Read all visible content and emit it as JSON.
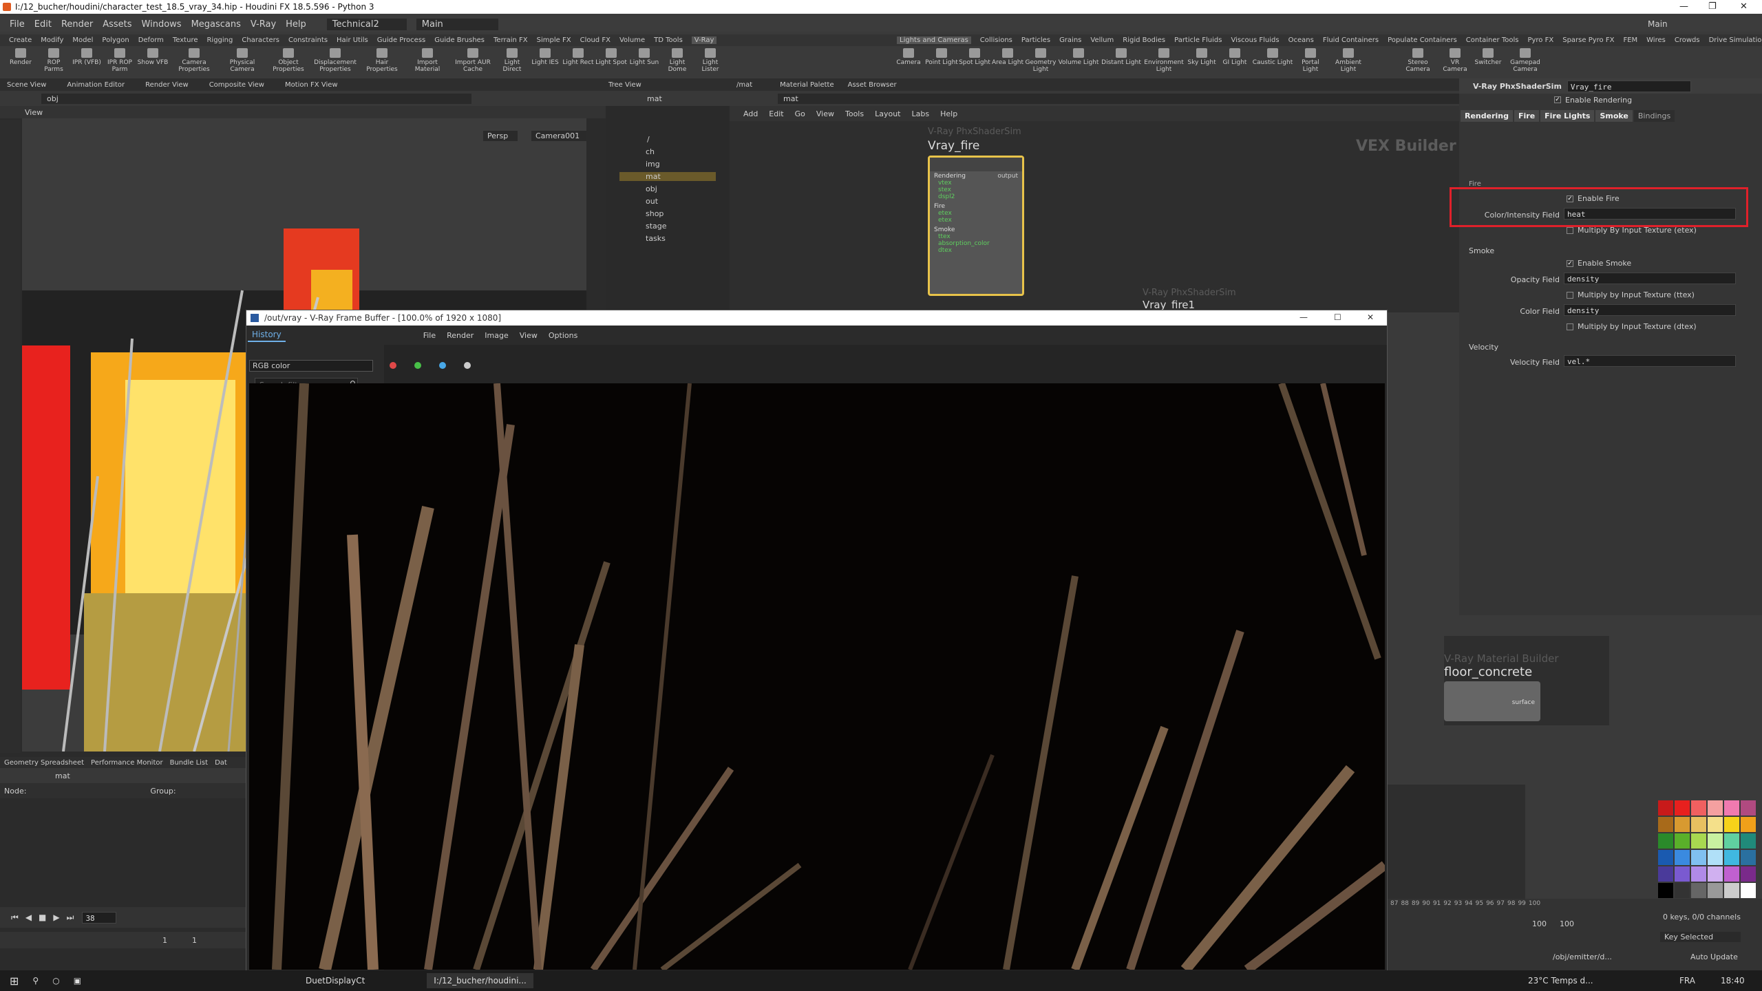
{
  "window": {
    "title": "I:/12_bucher/houdini/character_test_18.5_vray_34.hip - Houdini FX 18.5.596 - Python 3",
    "desktop_label": "Main"
  },
  "menu": [
    "File",
    "Edit",
    "Render",
    "Assets",
    "Windows",
    "Megascans",
    "V-Ray",
    "Help"
  ],
  "desktop": {
    "name": "Technical2",
    "context": "Main"
  },
  "shelf_tabs_left": [
    "Create",
    "Modify",
    "Model",
    "Polygon",
    "Deform",
    "Texture",
    "Rigging",
    "Characters",
    "Constraints",
    "Hair Utils",
    "Guide Process",
    "Guide Brushes",
    "Terrain FX",
    "Simple FX",
    "Cloud FX",
    "Volume",
    "TD Tools",
    "V-Ray"
  ],
  "shelf_tools_left": [
    "Render",
    "ROP Parms",
    "IPR (VFB)",
    "IPR ROP Parm",
    "Show VFB",
    "Camera Properties",
    "Physical Camera",
    "Object Properties",
    "Displacement Properties",
    "Hair Properties",
    "Import Material",
    "Import AUR Cache",
    "Light Direct",
    "Light IES",
    "Light Rect",
    "Light Spot",
    "Light Sun",
    "Light Dome",
    "Light Lister"
  ],
  "shelf_tabs_right": [
    "Lights and Cameras",
    "Collisions",
    "Particles",
    "Grains",
    "Vellum",
    "Rigid Bodies",
    "Particle Fluids",
    "Viscous Fluids",
    "Oceans",
    "Fluid Containers",
    "Populate Containers",
    "Container Tools",
    "Pyro FX",
    "Sparse Pyro FX",
    "FEM",
    "Wires",
    "Crowds",
    "Drive Simulation"
  ],
  "shelf_tools_right": [
    "Camera",
    "Point Light",
    "Spot Light",
    "Area Light",
    "Geometry Light",
    "Volume Light",
    "Distant Light",
    "Environment Light",
    "Sky Light",
    "GI Light",
    "Caustic Light",
    "Portal Light",
    "Ambient Light",
    "Stereo Camera",
    "VR Camera",
    "Switcher",
    "Gamepad Camera"
  ],
  "left_tabs": [
    "Scene View",
    "Animation Editor",
    "Render View",
    "Composite View",
    "Motion FX View"
  ],
  "viewport": {
    "path": "obj",
    "label": "View",
    "persp": "Persp",
    "camera": "Camera001"
  },
  "bottom_left_tabs": [
    "Geometry Spreadsheet",
    "Performance Monitor",
    "Bundle List",
    "Dat"
  ],
  "spreadsheet": {
    "path": "mat",
    "node_label": "Node:",
    "group_label": "Group:"
  },
  "timeline": {
    "frame": "38",
    "start": "1",
    "start2": "1"
  },
  "tree": {
    "tab": "Tree View",
    "path": "mat",
    "items": [
      "/",
      "ch",
      "img",
      "mat",
      "obj",
      "out",
      "shop",
      "stage",
      "tasks"
    ]
  },
  "network": {
    "tabs": [
      "/mat",
      "Material Palette",
      "Asset Browser"
    ],
    "path": "mat",
    "menu": [
      "Add",
      "Edit",
      "Go",
      "View",
      "Tools",
      "Layout",
      "Labs",
      "Help"
    ],
    "builder_label": "VEX Builder",
    "node1": {
      "type": "V-Ray PhxShaderSim",
      "name": "Vray_fire",
      "ports": [
        "Rendering",
        "vtex",
        "stex",
        "dspl2",
        "Fire",
        "etex",
        "etex",
        "Smoke",
        "ttex",
        "absorption_color",
        "dtex"
      ],
      "out": "output"
    },
    "node2": {
      "type": "V-Ray PhxShaderSim",
      "name": "Vray_fire1"
    },
    "node3": {
      "type": "V-Ray Material Builder",
      "name": "floor_concrete",
      "out": "surface"
    }
  },
  "params": {
    "node_type": "V-Ray PhxShaderSim",
    "node_name": "Vray_fire",
    "enable_rendering": "Enable Rendering",
    "tabs": [
      "Rendering",
      "Fire",
      "Fire Lights",
      "Smoke",
      "Bindings"
    ],
    "fire_section": "Fire",
    "enable_fire": "Enable Fire",
    "color_field_label": "Color/Intensity Field",
    "color_field_value": "heat",
    "mult_etex": "Multiply By Input Texture (etex)",
    "smoke_section": "Smoke",
    "enable_smoke": "Enable Smoke",
    "opacity_label": "Opacity Field",
    "opacity_value": "density",
    "mult_ttex": "Multiply by Input Texture (ttex)",
    "color_label": "Color Field",
    "color_value": "density",
    "mult_dtex": "Multiply by Input Texture (dtex)",
    "velocity_section": "Velocity",
    "velocity_label": "Velocity Field",
    "velocity_value": "vel.*"
  },
  "vfb": {
    "title": "/out/vray - V-Ray Frame Buffer - [100.0% of 1920 x 1080]",
    "menu": [
      "File",
      "Render",
      "Image",
      "View",
      "Options"
    ],
    "history": "History",
    "search_placeholder": "Search filter",
    "channel": "RGB color"
  },
  "right_timeline": {
    "ticks": [
      "87",
      "88",
      "89",
      "90",
      "91",
      "92",
      "93",
      "94",
      "95",
      "96",
      "97",
      "98",
      "99",
      "100"
    ],
    "end1": "100",
    "end2": "100",
    "keys": "0 keys, 0/0 channels",
    "key_mode": "Key Selected",
    "path": "/obj/emitter/d...",
    "auto_update": "Auto Update"
  },
  "taskbar": {
    "app1": "DuetDisplayCt",
    "app2": "I:/12_bucher/houdini...",
    "weather": "23°C  Temps d...",
    "lang": "FRA",
    "time": "18:40"
  },
  "colors": {
    "accent_red": "#e0202a",
    "node_outline": "#e8c34a"
  }
}
